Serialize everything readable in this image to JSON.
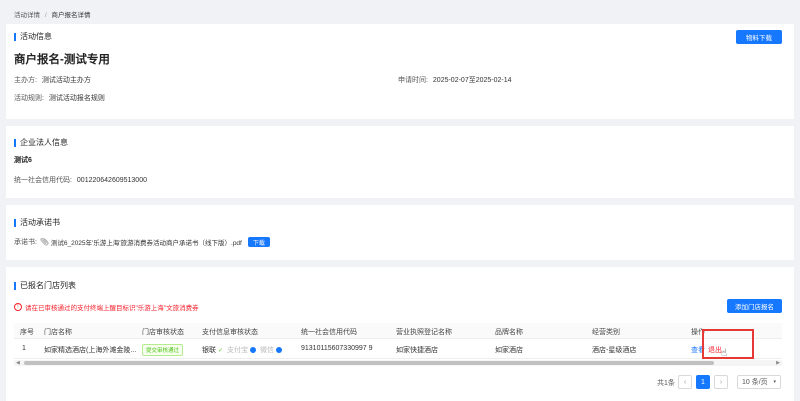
{
  "breadcrumb": {
    "item1": "活动详情",
    "sep": "/",
    "item2": "商户报名详情"
  },
  "activity": {
    "section_title": "活动信息",
    "download_btn": "物料下载",
    "name": "商户报名-测试专用",
    "organizer_label": "主办方:",
    "organizer_value": "测试活动主办方",
    "apply_time_label": "申请时间:",
    "apply_time_value": "2025-02-07至2025-02-14",
    "rule_label": "活动规则:",
    "rule_value": "测试活动报名规则"
  },
  "enterprise": {
    "section_title": "企业法人信息",
    "company_name": "测试6",
    "credit_label": "统一社会信用代码:",
    "credit_value": "001220642609513000"
  },
  "commitment": {
    "section_title": "活动承诺书",
    "label": "承诺书:",
    "file_name": "测试6_2025年'乐游上海'旅游消费券活动商户承诺书（线下版）.pdf",
    "download_btn": "下载"
  },
  "stores": {
    "section_title": "已报名门店列表",
    "warning": "请在已审核通过的支付终端上醒目标识\"乐游上海\"文旅消费券",
    "add_btn": "添加门店报名",
    "columns": [
      "序号",
      "门店名称",
      "门店审核状态",
      "支付信息审核状态",
      "统一社会信用代码",
      "营业执照登记名称",
      "品牌名称",
      "经营类别",
      "操作"
    ],
    "rows": [
      {
        "index": "1",
        "store_name": "如家精选酒店(上海外滩金陵...",
        "audit_status": "提交审核通过",
        "pay_status_1": "银联",
        "pay_status_2": "支付宝",
        "pay_status_3": "微信",
        "credit_code": "91310115607330997 9",
        "license_name": "如家快捷酒店",
        "brand": "如家酒店",
        "category": "酒店-星级酒店",
        "action_view": "查看",
        "action_exit": "退出"
      }
    ]
  },
  "pagination": {
    "total": "共1条",
    "current": "1",
    "page_size": "10 条/页"
  },
  "colors": {
    "accent": "#1677ff",
    "danger": "#f5222d",
    "success": "#52c41a",
    "highlight": "#e53935"
  }
}
